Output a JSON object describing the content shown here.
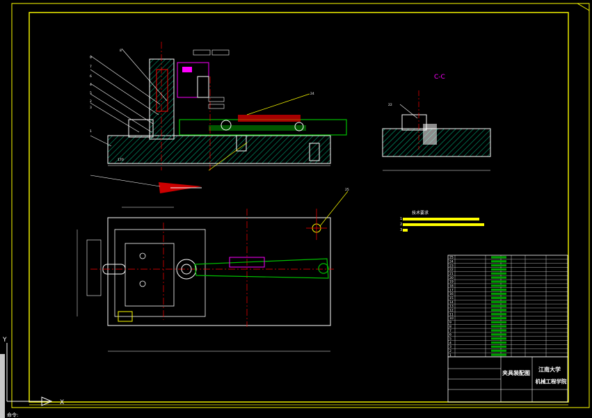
{
  "section_label": "C-C",
  "tech_req": {
    "title": "技术要求",
    "lines": [
      "1",
      "2",
      "3"
    ]
  },
  "title_block": {
    "drawing_name": "夹具装配图",
    "university": "江南大学",
    "school": "机械工程学院"
  },
  "bom_numbers": [
    "1",
    "2",
    "3",
    "4",
    "5",
    "6",
    "7",
    "8",
    "9",
    "10",
    "11",
    "12",
    "13",
    "14",
    "15",
    "16",
    "17",
    "18",
    "19",
    "20",
    "21",
    "22",
    "23",
    "24",
    "25"
  ],
  "balloon_labels": [
    "1",
    "2",
    "3",
    "4",
    "5",
    "6",
    "7",
    "8",
    "9",
    "22",
    "24",
    "25"
  ],
  "ucs": {
    "x_axis": "X",
    "y_axis": "Y"
  },
  "status_text": "命令:"
}
